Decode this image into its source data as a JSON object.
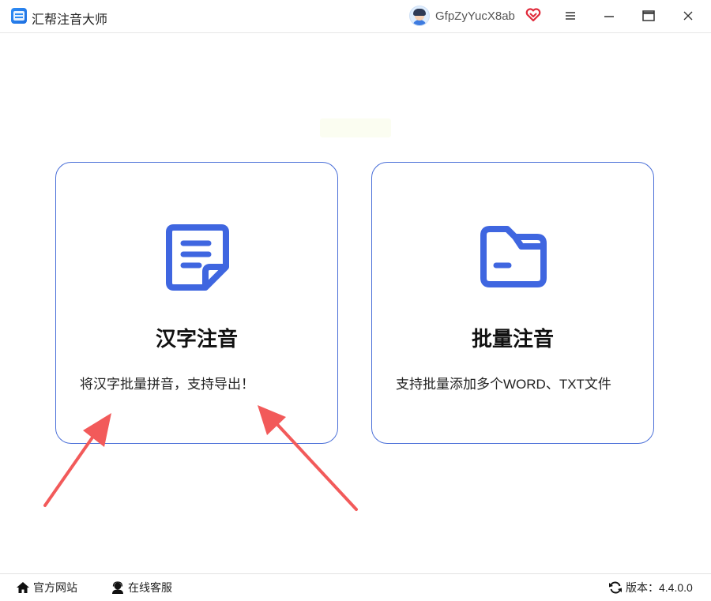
{
  "app": {
    "title": "汇帮注音大师"
  },
  "user": {
    "name": "GfpZyYucX8ab"
  },
  "colors": {
    "accent": "#3f66e0",
    "card_border": "#4a6fd8",
    "arrow": "#f25a5a",
    "vip": "#e0293a"
  },
  "cards": [
    {
      "title": "汉字注音",
      "desc": "将汉字批量拼音，支持导出！",
      "icon": "document-icon"
    },
    {
      "title": "批量注音",
      "desc": "支持批量添加多个WORD、TXT文件",
      "icon": "folder-icon"
    }
  ],
  "footer": {
    "site_label": "官方网站",
    "service_label": "在线客服",
    "version_label": "版本：4.4.0.0"
  }
}
